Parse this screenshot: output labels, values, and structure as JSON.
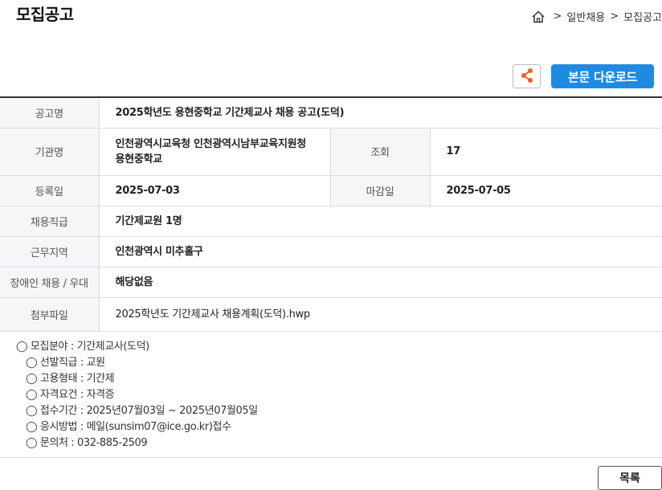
{
  "header": {
    "title": "모집공고",
    "breadcrumb": {
      "sep1": ">",
      "item1": "일반채용",
      "sep2": ">",
      "item2": "모집공고"
    }
  },
  "actions": {
    "share_icon": "share-icon",
    "download_label": "본문 다운로드",
    "list_label": "목록"
  },
  "colors": {
    "accent": "#1f8ae0",
    "share_icon": "#e8622b"
  },
  "info": {
    "rows": {
      "title": {
        "label": "공고명",
        "value": "2025학년도 용현중학교 기간제교사 채용 공고(도덕)"
      },
      "org": {
        "label": "기관명",
        "value": "인천광역시교육청 인천광역시남부교육지원청 용현중학교"
      },
      "views": {
        "label": "조회",
        "value": "17"
      },
      "reg_date": {
        "label": "등록일",
        "value": "2025-07-03"
      },
      "deadline": {
        "label": "마감일",
        "value": "2025-07-05"
      },
      "position": {
        "label": "채용직급",
        "value": "기간제교원 1명"
      },
      "location": {
        "label": "근무지역",
        "value": "인천광역시 미추홀구"
      },
      "disabled": {
        "label": "장애인 채용 / 우대",
        "value": "해당없음"
      },
      "attachment": {
        "label": "첨부파일",
        "value": "2025학년도 기간제교사 채용계획(도덕).hwp"
      }
    }
  },
  "details": {
    "main": "◯ 모집분야 : 기간제교사(도덕)",
    "items": [
      "◯ 선발직급 : 교원",
      "◯ 고용형태 : 기간제",
      "◯ 자격요건 : 자격증",
      "◯ 접수기간 : 2025년07월03일 ~ 2025년07월05일",
      "◯ 응시방법 : 메일(sunsim07@ice.go.kr)접수",
      "◯ 문의처 : 032-885-2509"
    ]
  }
}
